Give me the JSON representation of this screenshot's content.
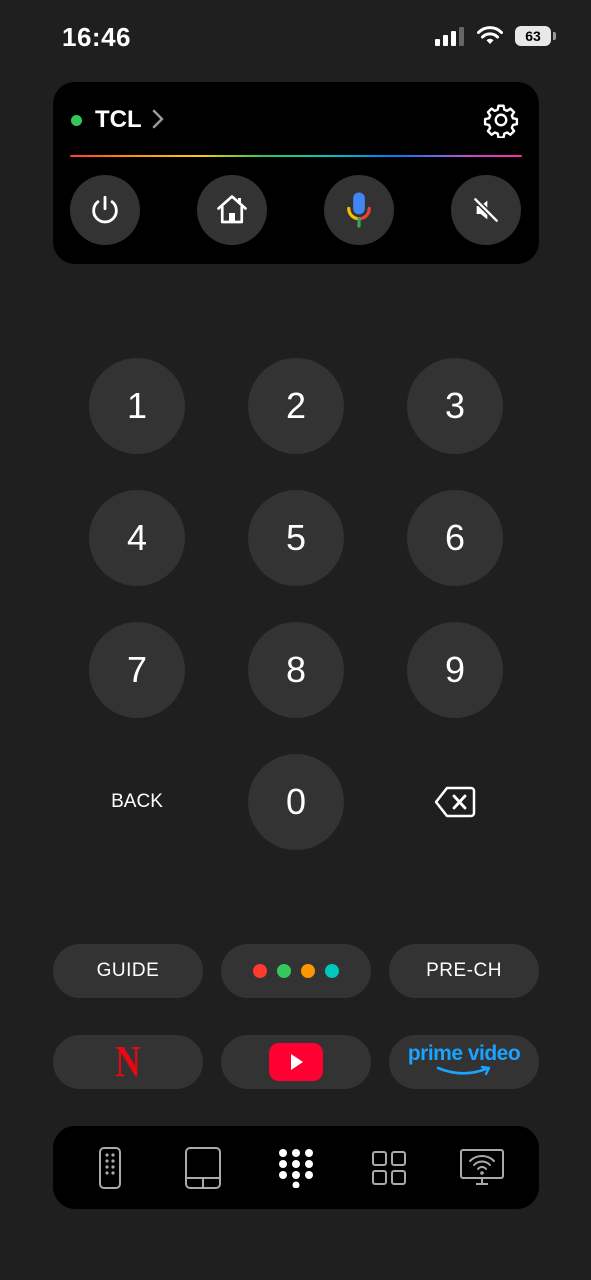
{
  "status_bar": {
    "time": "16:46",
    "battery": "63"
  },
  "device": {
    "name": "TCL",
    "status_color": "#34c759"
  },
  "keypad": {
    "keys": [
      "1",
      "2",
      "3",
      "4",
      "5",
      "6",
      "7",
      "8",
      "9",
      "0"
    ],
    "back_label": "BACK"
  },
  "shortcuts": {
    "guide_label": "GUIDE",
    "prech_label": "PRE-CH",
    "color_buttons": [
      "#ff3b30",
      "#34c759",
      "#ff9500",
      "#00c7be"
    ]
  },
  "apps": {
    "netflix": "N",
    "prime_line1": "prime video",
    "prime_color": "#1aa3ff",
    "youtube_color": "#ff0033",
    "netflix_color": "#e50914"
  },
  "icons": {
    "power": "power-icon",
    "home": "home-icon",
    "mic": "microphone-icon",
    "mute": "mute-icon",
    "settings": "gear-icon",
    "backspace": "backspace-icon",
    "nav": [
      "remote-icon",
      "touchpad-icon",
      "keypad-icon",
      "apps-grid-icon",
      "screen-cast-icon"
    ]
  },
  "colors": {
    "background": "#1f1f1f",
    "button": "#333333",
    "card": "#000000"
  }
}
